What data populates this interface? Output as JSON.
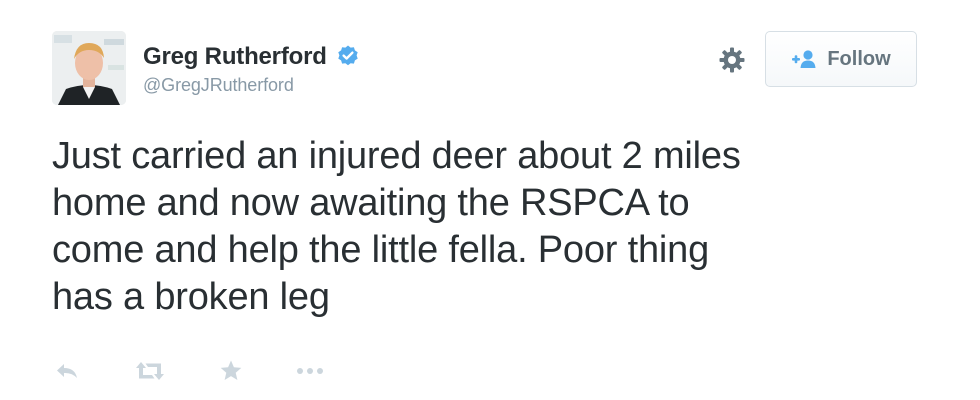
{
  "user": {
    "display_name": "Greg Rutherford",
    "handle": "@GregJRutherford",
    "verified": true,
    "avatar_icon": "profile-photo"
  },
  "header": {
    "settings_icon": "gear-icon",
    "follow_label": "Follow",
    "follow_icon": "add-user-icon"
  },
  "tweet": {
    "text": "Just carried an injured deer about 2 miles\nhome and now awaiting the RSPCA to\ncome and help the little fella. Poor thing\nhas a broken leg"
  },
  "actions": [
    {
      "name": "reply",
      "icon": "reply-icon"
    },
    {
      "name": "retweet",
      "icon": "retweet-icon"
    },
    {
      "name": "favorite",
      "icon": "star-icon"
    },
    {
      "name": "more",
      "icon": "more-icon"
    }
  ],
  "colors": {
    "text": "#292f33",
    "muted": "#8899a6",
    "verified": "#55acee",
    "follow_icon": "#55acee",
    "action_icon": "#ccd6dd"
  }
}
